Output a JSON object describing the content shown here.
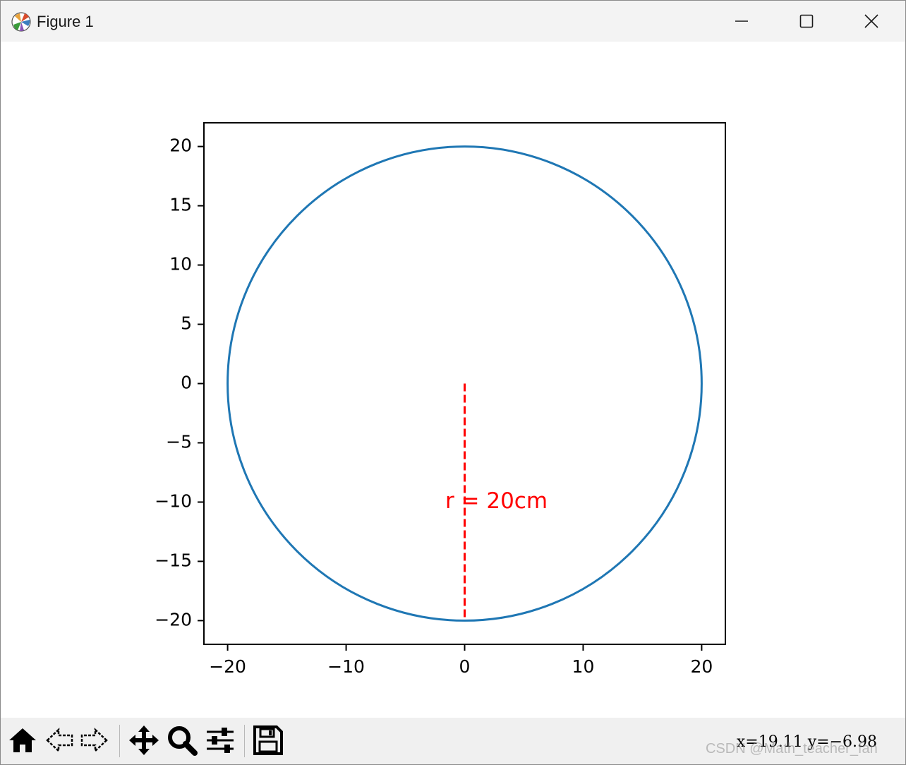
{
  "window": {
    "title": "Figure 1",
    "controls": [
      "minimize",
      "maximize",
      "close"
    ]
  },
  "toolbar": {
    "tools": [
      "home-icon",
      "back-icon",
      "forward-icon",
      "pan-icon",
      "zoom-icon",
      "configure-subplots-icon",
      "save-icon"
    ],
    "coords": "x=19.11  y=−6.98"
  },
  "watermark": "CSDN @Math_teacher_fan",
  "colors": {
    "circle": "#1f77b4",
    "radius_line": "#ff0000",
    "annotation": "#ff0000"
  },
  "chart_data": {
    "type": "line",
    "title": "",
    "xlabel": "",
    "ylabel": "",
    "xlim": [
      -22,
      22
    ],
    "ylim": [
      -22,
      22
    ],
    "xticks": [
      -20,
      -10,
      0,
      10,
      20
    ],
    "yticks": [
      -20,
      -15,
      -10,
      -5,
      0,
      5,
      10,
      15,
      20
    ],
    "xtick_labels": [
      "−20",
      "−10",
      "0",
      "10",
      "20"
    ],
    "ytick_labels": [
      "−20",
      "−15",
      "−10",
      "−5",
      "0",
      "5",
      "10",
      "15",
      "20"
    ],
    "grid": false,
    "series": [
      {
        "kind": "circle",
        "center": [
          0,
          0
        ],
        "radius": 20,
        "style": "solid",
        "color": "#1f77b4"
      },
      {
        "kind": "segment",
        "x": [
          0,
          0
        ],
        "y": [
          0,
          -20
        ],
        "style": "dashed",
        "color": "#ff0000"
      }
    ],
    "annotations": [
      {
        "text": "r = 20cm",
        "x": 0,
        "y": -10,
        "color": "#ff0000"
      }
    ]
  }
}
